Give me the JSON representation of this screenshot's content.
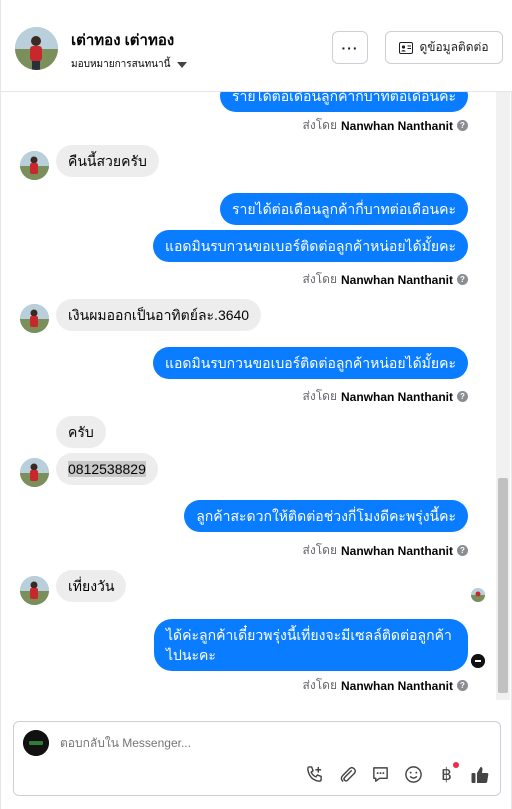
{
  "header": {
    "name": "เต่าทอง เต่าทอง",
    "assign": "มอบหมายการสนทนานี้",
    "more_label": "···",
    "contact_label": "ดูข้อมูลติดต่อ"
  },
  "messages": {
    "m0_text": "รายได้ต่อเดือนลูกค้ากี่บาทต่อเดือนคะ",
    "m1_text": "คืนนี้สวยครับ",
    "m2_text": "รายได้ต่อเดือนลูกค้ากี่บาทต่อเดือนคะ",
    "m3_text": "แอดมินรบกวนขอเบอร์ติดต่อลูกค้าหน่อยได้มั้ยคะ",
    "m4_text": "เงินผมออกเป็นอาทิตย์ละ.3640",
    "m5_text": "แอดมินรบกวนขอเบอร์ติดต่อลูกค้าหน่อยได้มั้ยคะ",
    "m6_text": "ครับ",
    "m7_text": "0812538829",
    "m8_text": "ลูกค้าสะดวกให้ติดต่อช่วงกี่โมงดีคะพรุ่งนี้คะ",
    "m9_text": "เที่ยงวัน",
    "m10_line1": "ได้ค่ะลูกค้าเดี๋ยวพรุ่งนี้เที่ยงจะมีเซลล์ติดต่อลูกค้า",
    "m10_line2": "ไปนะคะ"
  },
  "sent_by": {
    "prefix": "ส่งโดย",
    "agent": "Nanwhan Nanthanit",
    "help_glyph": "?"
  },
  "composer": {
    "placeholder": "ตอบกลับใน Messenger...",
    "currency_glyph": "฿"
  },
  "colors": {
    "outgoing_bubble": "#0a7cff",
    "incoming_bubble": "#ededed",
    "notification_dot": "#f02849"
  }
}
